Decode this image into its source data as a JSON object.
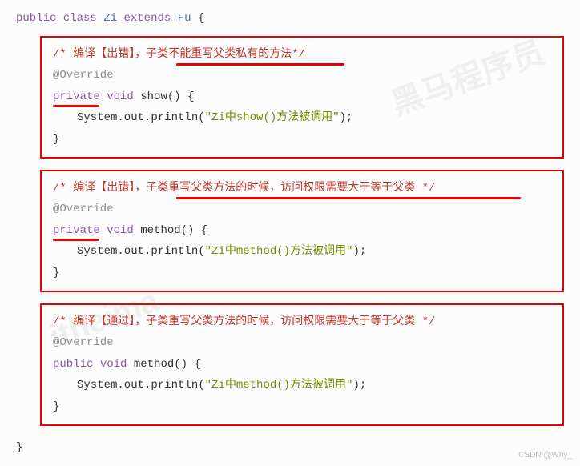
{
  "header": {
    "public": "public",
    "class": "class",
    "zi": "Zi",
    "extends": "extends",
    "fu": "Fu",
    "open": "{"
  },
  "block1": {
    "comment": "/* 编译【出错】，子类不能重写父类私有的方法*/",
    "anno": "@Override",
    "private": "private",
    "void": "void",
    "fn": "show",
    "sig": "() {",
    "sysout": "System.out.println(",
    "str": "\"Zi中show()方法被调用\"",
    "tail": ");",
    "close": "}"
  },
  "block2": {
    "comment": "/* 编译【出错】，子类重写父类方法的时候，访问权限需要大于等于父类 */",
    "anno": "@Override",
    "private": "private",
    "void": "void",
    "fn": "method",
    "sig": "() {",
    "sysout": "System.out.println(",
    "str": "\"Zi中method()方法被调用\"",
    "tail": ");",
    "close": "}"
  },
  "block3": {
    "comment": "/* 编译【通过】，子类重写父类方法的时候，访问权限需要大于等于父类 */",
    "anno": "@Override",
    "public": "public",
    "void": "void",
    "fn": "method",
    "sig": "() {",
    "sysout": "System.out.println(",
    "str": "\"Zi中method()方法被调用\"",
    "tail": ");",
    "close": "}"
  },
  "footer": {
    "close": "}"
  },
  "attrib": "CSDN @Why_"
}
